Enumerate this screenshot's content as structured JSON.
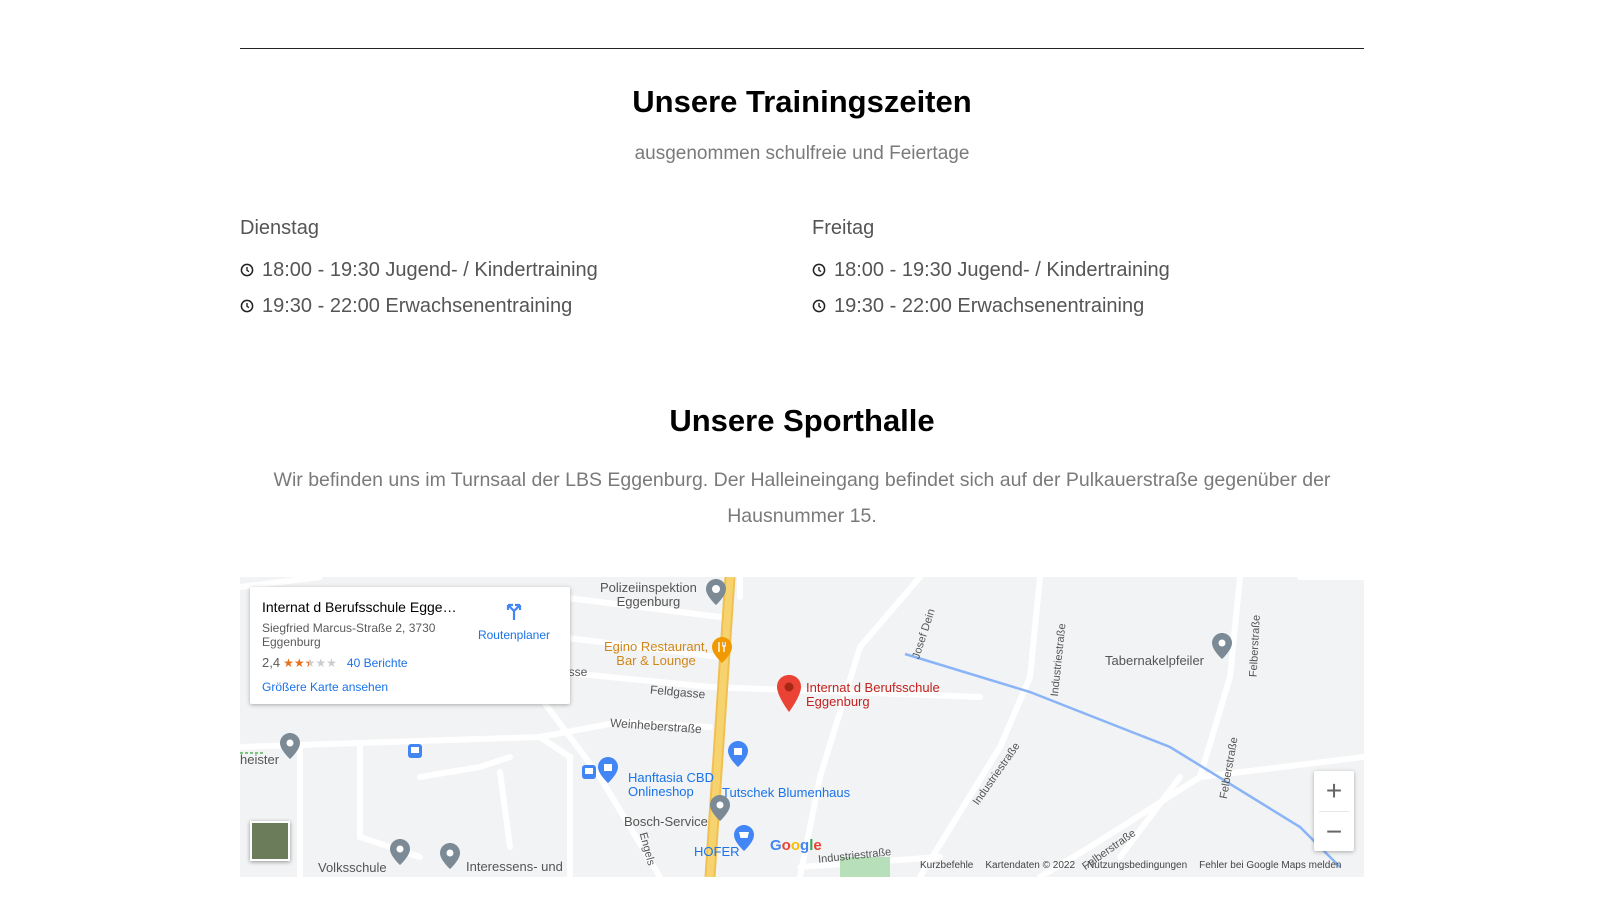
{
  "training": {
    "title": "Unsere Trainingszeiten",
    "subtitle": "ausgenommen schulfreie und Feiertage",
    "days": [
      {
        "day": "Dienstag",
        "slots": [
          "18:00 - 19:30 Jugend- / Kindertraining",
          "19:30 - 22:00 Erwachsenentraining"
        ]
      },
      {
        "day": "Freitag",
        "slots": [
          "18:00 - 19:30 Jugend- / Kindertraining",
          "19:30 - 22:00 Erwachsenentraining"
        ]
      }
    ],
    "icon": "clock-icon"
  },
  "hall": {
    "title": "Unsere Sporthalle",
    "description": "Wir befinden uns im Turnsaal der LBS Eggenburg. Der Halleineingang befindet sich auf der Pulkauerstraße gegenüber der Hausnummer 15."
  },
  "map": {
    "card": {
      "title": "Internat d Berufsschule Eggen…",
      "address": "Siegfried Marcus-Straße 2, 3730 Eggenburg",
      "rating": "2,4",
      "rating_value": 2.4,
      "reviews": "40 Berichte",
      "larger_map": "Größere Karte ansehen",
      "route": "Routenplaner"
    },
    "labels": {
      "polizei": "Polizeiinspektion\nEggenburg",
      "egino": "Egino Restaurant,\nBar & Lounge",
      "internat": "Internat d Berufsschule\nEggenburg",
      "tabernakel": "Tabernakelpfeiler",
      "feldgasse": "Feldgasse",
      "gasse": "asse",
      "weinheber": "Weinheberstraße",
      "heister": "heister",
      "hanftasia": "Hanftasia CBD\nOnlineshop",
      "tutschek": "Tutschek Blumenhaus",
      "bosch": "Bosch-Service",
      "hofer": "HOFER",
      "volksschule": "Volksschule",
      "interessens": "Interessens- und",
      "industrie1": "Industriestraße",
      "industrie2": "Industriestraße",
      "industrie3": "Industriestraße",
      "felber1": "Felberstraße",
      "felber2": "Felberstraße",
      "felber3": "Felberstraße",
      "josef": "Josef Dein",
      "engels": "Engels"
    },
    "google": "Google",
    "footer": [
      "Kurzbefehle",
      "Kartendaten © 2022",
      "Nutzungsbedingungen",
      "Fehler bei Google Maps melden"
    ],
    "colors": {
      "road_yellow": "#f7d370",
      "river": "#8ab4f8",
      "pin_red": "#ea4335",
      "poi_gray": "#7b8a95",
      "poi_blue": "#4285f4",
      "poi_orange": "#f29900"
    }
  }
}
